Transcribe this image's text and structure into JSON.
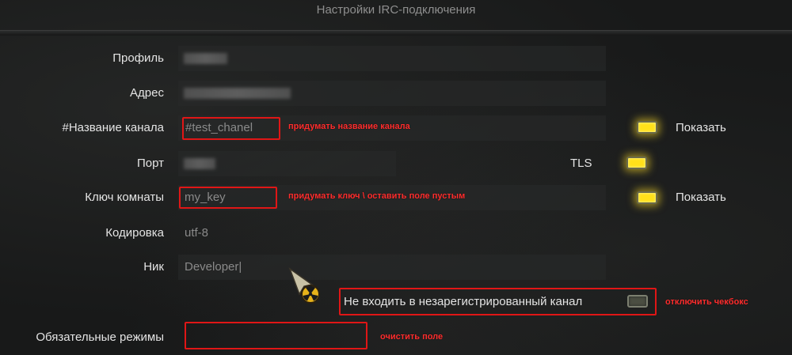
{
  "header": {
    "title": "Настройки IRC-подключения"
  },
  "form": {
    "profile_label": "Профиль",
    "address_label": "Адрес",
    "channel_label": "#Название канала",
    "channel_value": "#test_chanel",
    "channel_note": "придумать название канала",
    "channel_show_label": "Показать",
    "port_label": "Порт",
    "tls_label": "TLS",
    "key_label": "Ключ комнаты",
    "key_value": "my_key",
    "key_note": "придумать ключ \\ оставить поле пустым",
    "key_show_label": "Показать",
    "encoding_label": "Кодировка",
    "encoding_value": "utf-8",
    "nick_label": "Ник",
    "nick_value": "Developer|",
    "unregistered_label": "Не входить в незарегистрированный канал",
    "unregistered_note": "отключить чекбокс",
    "modes_label": "Обязательные режимы",
    "modes_note": "очистить поле"
  },
  "toggles": {
    "channel_show": true,
    "tls": true,
    "key_show": true,
    "unregistered": false
  },
  "icons": {
    "cursor": "radiation-cursor-icon"
  },
  "colors": {
    "annotation": "#e01616",
    "lamp_on": "#ffe01a"
  }
}
